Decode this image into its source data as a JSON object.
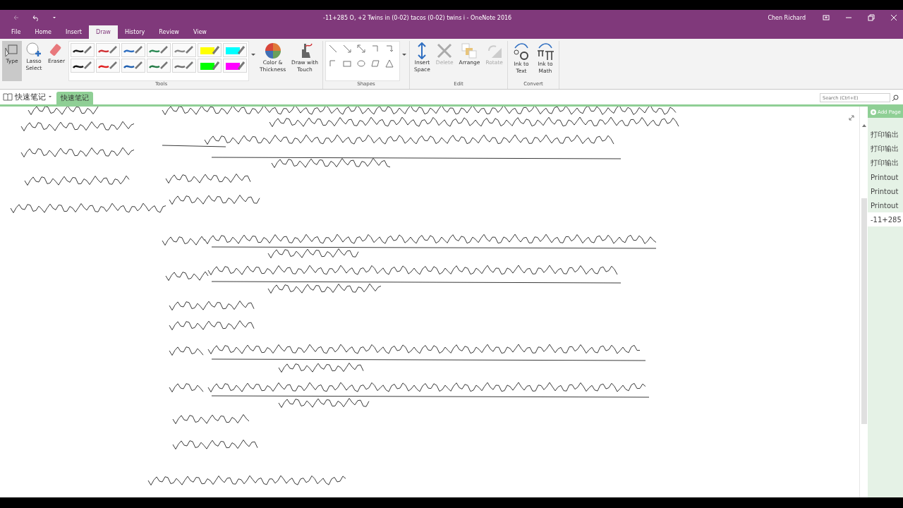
{
  "window": {
    "title": "-11+285 O, +2 Twins in (0-02) tacos (0-02) twins i  -  OneNote 2016",
    "user": "Chen Richard"
  },
  "tabs": [
    {
      "label": "File",
      "selected": false
    },
    {
      "label": "Home",
      "selected": false
    },
    {
      "label": "Insert",
      "selected": false
    },
    {
      "label": "Draw",
      "selected": true
    },
    {
      "label": "History",
      "selected": false
    },
    {
      "label": "Review",
      "selected": false
    },
    {
      "label": "View",
      "selected": false
    }
  ],
  "ribbon": {
    "tools_group": "Tools",
    "shapes_group": "Shapes",
    "edit_group": "Edit",
    "convert_group": "Convert",
    "tool_buttons": [
      {
        "kind": "type",
        "lines": [
          "Type"
        ],
        "selected": true
      },
      {
        "kind": "lasso",
        "lines": [
          "Lasso",
          "Select"
        ],
        "selected": false
      },
      {
        "kind": "eraser",
        "lines": [
          "Eraser"
        ],
        "selected": false
      }
    ],
    "pens": [
      {
        "kind": "pen",
        "color": "#222222"
      },
      {
        "kind": "pen",
        "color": "#d13438"
      },
      {
        "kind": "pen",
        "color": "#2f6fc1"
      },
      {
        "kind": "pen",
        "color": "#2e8b57"
      },
      {
        "kind": "pen",
        "color": "#8a8a8a"
      },
      {
        "kind": "highlighter",
        "color": "#ffff00"
      },
      {
        "kind": "highlighter",
        "color": "#00ffff"
      },
      {
        "kind": "pen",
        "color": "#111111"
      },
      {
        "kind": "pen",
        "color": "#e02020"
      },
      {
        "kind": "pen",
        "color": "#1f5fb0"
      },
      {
        "kind": "pen",
        "color": "#237a45"
      },
      {
        "kind": "pen",
        "color": "#6e6e6e"
      },
      {
        "kind": "highlighter",
        "color": "#00ff00"
      },
      {
        "kind": "highlighter",
        "color": "#ff00ff"
      }
    ],
    "draw_buttons": [
      {
        "kind": "color",
        "lines": [
          "Color &",
          "Thickness"
        ]
      },
      {
        "kind": "touch",
        "lines": [
          "Draw with",
          "Touch"
        ]
      }
    ],
    "edit_buttons": [
      {
        "kind": "space",
        "lines": [
          "Insert",
          "Space"
        ],
        "disabled": false
      },
      {
        "kind": "delete",
        "lines": [
          "Delete"
        ],
        "disabled": true
      },
      {
        "kind": "arrange",
        "lines": [
          "Arrange"
        ],
        "disabled": false
      },
      {
        "kind": "rotate",
        "lines": [
          "Rotate"
        ],
        "disabled": true
      }
    ],
    "convert_buttons": [
      {
        "kind": "text",
        "lines": [
          "Ink to",
          "Text"
        ]
      },
      {
        "kind": "math",
        "lines": [
          "Ink to",
          "Math"
        ]
      }
    ]
  },
  "notebook": {
    "name": "快速笔记",
    "section": "快速笔记",
    "search": {
      "placeholder": "Search (Ctrl+E)"
    }
  },
  "pages": {
    "add": "Add Page",
    "items": [
      {
        "title": "打印输出",
        "selected": false
      },
      {
        "title": "打印输出",
        "selected": false
      },
      {
        "title": "打印输出",
        "selected": false
      },
      {
        "title": "Printout",
        "selected": false
      },
      {
        "title": "Printout",
        "selected": false
      },
      {
        "title": "Printout",
        "selected": false
      },
      {
        "title": "-11+285",
        "selected": true
      }
    ]
  }
}
